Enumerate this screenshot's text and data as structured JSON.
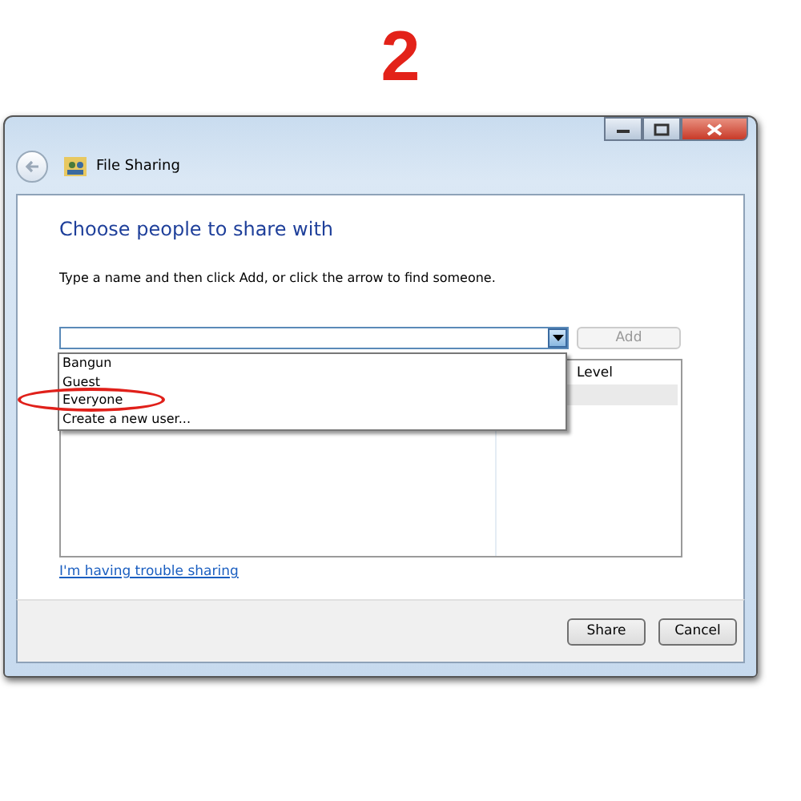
{
  "step_number": "2",
  "window": {
    "title": "File Sharing"
  },
  "heading": "Choose people to share with",
  "instruction": "Type a name and then click Add, or click the arrow to find someone.",
  "name_field": {
    "expanded": true
  },
  "add_button": {
    "label": "Add",
    "disabled": true
  },
  "dropdown_items": [
    {
      "label": "Bangun",
      "circled": false
    },
    {
      "label": "Guest",
      "circled": false
    },
    {
      "label": "Everyone",
      "circled": true
    },
    {
      "label": "Create a new user...",
      "circled": false
    }
  ],
  "table": {
    "columns": [
      "Level"
    ]
  },
  "help_link": "I'm having trouble sharing",
  "buttons": [
    "Share",
    "Cancel"
  ]
}
